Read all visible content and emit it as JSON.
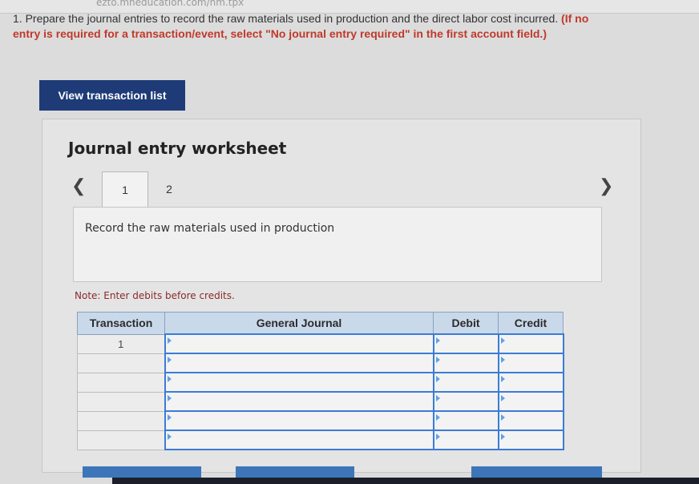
{
  "browser": {
    "url_fragment": "ezto.mheducation.com/hm.tpx"
  },
  "instructions": {
    "number": "1.",
    "text": "Prepare the journal entries to record the raw materials used in production and the direct labor cost incurred.",
    "emphasis": "(If no entry is required for a transaction/event, select \"No journal entry required\" in the first account field.)"
  },
  "view_button": {
    "label": "View transaction list"
  },
  "worksheet": {
    "title": "Journal entry worksheet",
    "tabs": [
      {
        "label": "1"
      },
      {
        "label": "2"
      }
    ],
    "prev_icon": "chevron-left-icon",
    "next_icon": "chevron-right-icon",
    "description": "Record the raw materials used in production",
    "note": "Note: Enter debits before credits.",
    "table": {
      "headers": [
        "Transaction",
        "General Journal",
        "Debit",
        "Credit"
      ],
      "rows": [
        {
          "transaction": "1",
          "account": "",
          "debit": "",
          "credit": ""
        },
        {
          "transaction": "",
          "account": "",
          "debit": "",
          "credit": ""
        },
        {
          "transaction": "",
          "account": "",
          "debit": "",
          "credit": ""
        },
        {
          "transaction": "",
          "account": "",
          "debit": "",
          "credit": ""
        },
        {
          "transaction": "",
          "account": "",
          "debit": "",
          "credit": ""
        },
        {
          "transaction": "",
          "account": "",
          "debit": "",
          "credit": ""
        }
      ]
    }
  },
  "colors": {
    "button_bg": "#1e3b78",
    "header_bg": "#c9d9ea",
    "emphasis": "#c0392b",
    "note": "#8b2a2a"
  }
}
